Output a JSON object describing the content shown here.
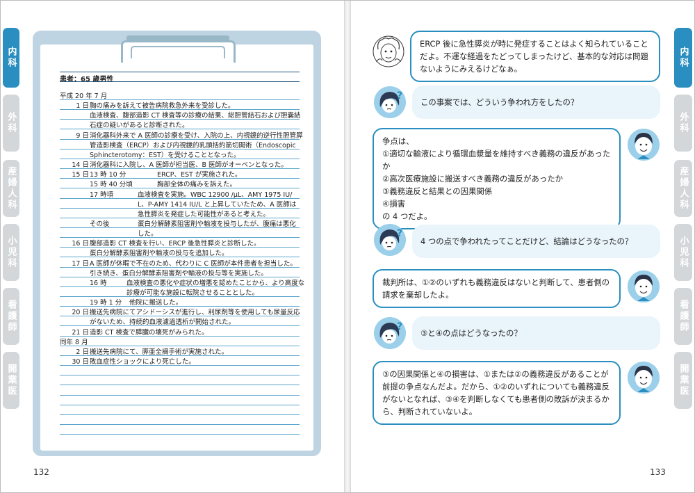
{
  "tabs": [
    {
      "label": "内科",
      "active": true
    },
    {
      "label": "外科",
      "active": false
    },
    {
      "label": "産婦人科",
      "active": false
    },
    {
      "label": "小児科",
      "active": false
    },
    {
      "label": "看護師",
      "active": false
    },
    {
      "label": "開業医",
      "active": false
    }
  ],
  "record": {
    "patient": "患者：65 歳男性",
    "rows": [
      {
        "d": "平成 20 年 7 月",
        "t": "",
        "x": ""
      },
      {
        "d": "1 日",
        "t": "胸の痛みを訴えて被告病院救急外来を受診した。",
        "x": ""
      },
      {
        "d": "",
        "t": "血液検査、腹部造影 CT 検査等の診療の結果、総胆管結石および胆嚢結",
        "x": ""
      },
      {
        "d": "",
        "t": "石症の疑いがあると診断された。",
        "x": ""
      },
      {
        "d": "9 日",
        "t": "消化器科外来で A 医師の診療を受け、入院の上、内視鏡的逆行性胆管膵",
        "x": ""
      },
      {
        "d": "",
        "t": "管造影検査（ERCP）および内視鏡的乳頭括約筋切開術（Endoscopic",
        "x": ""
      },
      {
        "d": "",
        "t": "Sphincterotomy：EST）を受けることとなった。",
        "x": ""
      },
      {
        "d": "14 日",
        "t": "消化器科に入院し、A 医師が担当医、B 医師がオーベンとなった。",
        "x": ""
      },
      {
        "d": "15 日",
        "t": "13 時 10 分",
        "x": "ERCP、EST が実施された。"
      },
      {
        "d": "",
        "t": "15 時 40 分頃",
        "x": "胸部全体の痛みを訴えた。"
      },
      {
        "d": "",
        "t": "17 時頃",
        "x": "血液検査を実施。WBC 12900 /μL、AMY 1975 IU/"
      },
      {
        "d": "",
        "t": "",
        "x": "L、P-AMY 1414 IU/L と上昇していたため、A 医師は"
      },
      {
        "d": "",
        "t": "",
        "x": "急性膵炎を発症した可能性があると考えた。"
      },
      {
        "d": "",
        "t": "その後",
        "x": "蛋白分解酵素阻害剤や輸液を投与したが、腹痛は悪化"
      },
      {
        "d": "",
        "t": "",
        "x": "した。"
      },
      {
        "d": "16 日",
        "t": "腹部造影 CT 検査を行い、ERCP 後急性膵炎と診断した。",
        "x": ""
      },
      {
        "d": "",
        "t": "蛋白分解酵素阻害剤や輸液の投与を追加した。",
        "x": ""
      },
      {
        "d": "17 日",
        "t": "A 医師が休暇で不在のため、代わりに C 医師が本件患者を担当した。",
        "x": ""
      },
      {
        "d": "",
        "t": "引き続き、蛋白分解酵素阻害剤や輸液の投与等を実施した。",
        "x": ""
      },
      {
        "d": "",
        "t": "16 時",
        "x": "血液検査の悪化や症状の増悪を認めたことから、より高度な"
      },
      {
        "d": "",
        "t": "",
        "x": "診療が可能な施設に転院させることとした。"
      },
      {
        "d": "",
        "t": "19 時 1 分",
        "x": "他院に搬送した。"
      },
      {
        "d": "20 日",
        "t": "搬送先病院にてアシドーシスが進行し、利尿剤等を使用しても尿量反応",
        "x": ""
      },
      {
        "d": "",
        "t": "がないため、持続的血液濾過透析が開始された。",
        "x": ""
      },
      {
        "d": "21 日",
        "t": "造影 CT 検査で膵臓の壊死がみられた。",
        "x": ""
      },
      {
        "d": "同年 8 月",
        "t": "",
        "x": ""
      },
      {
        "d": "2 日",
        "t": "搬送先病院にて、膵亜全摘手術が実施された。",
        "x": ""
      },
      {
        "d": "30 日",
        "t": "敗血症性ショックにより死亡した。",
        "x": ""
      }
    ]
  },
  "chat": [
    {
      "speaker": "senior",
      "text": "ERCP 後に急性膵炎が時に発症することはよく知られていることだよ。不運な経過をたどってしまったけど、基本的な対応は問題ないようにみえるけどなぁ。"
    },
    {
      "speaker": "girl",
      "text": "この事案では、どういう争われ方をしたの？"
    },
    {
      "speaker": "lawyer",
      "text": "争点は、\n①適切な輸液により循環血漿量を維持すべき義務の違反があったか\n②高次医療施設に搬送すべき義務の違反があったか\n③義務違反と結果との因果関係\n④損害\nの 4 つだよ。"
    },
    {
      "speaker": "girl",
      "text": "4 つの点で争われたってことだけど、結論はどうなったの？"
    },
    {
      "speaker": "lawyer",
      "text": "裁判所は、①②のいずれも義務違反はないと判断して、患者側の請求を棄却したよ。"
    },
    {
      "speaker": "girl",
      "text": "③と④の点はどうなったの？"
    },
    {
      "speaker": "lawyer",
      "text": "③の因果関係と④の損害は、①または②の義務違反があることが前提の争点なんだよ。だから、①②のいずれについても義務違反がないとなれば、③④を判断しなくても患者側の敗訴が決まるから、判断されていないよ。"
    }
  ],
  "page_numbers": {
    "left": "132",
    "right": "133"
  },
  "colors": {
    "accent": "#2a8fc0",
    "tab_inactive": "#d4d7da",
    "board": "#bed4e2",
    "bubble_fill": "#e9f4fb"
  }
}
